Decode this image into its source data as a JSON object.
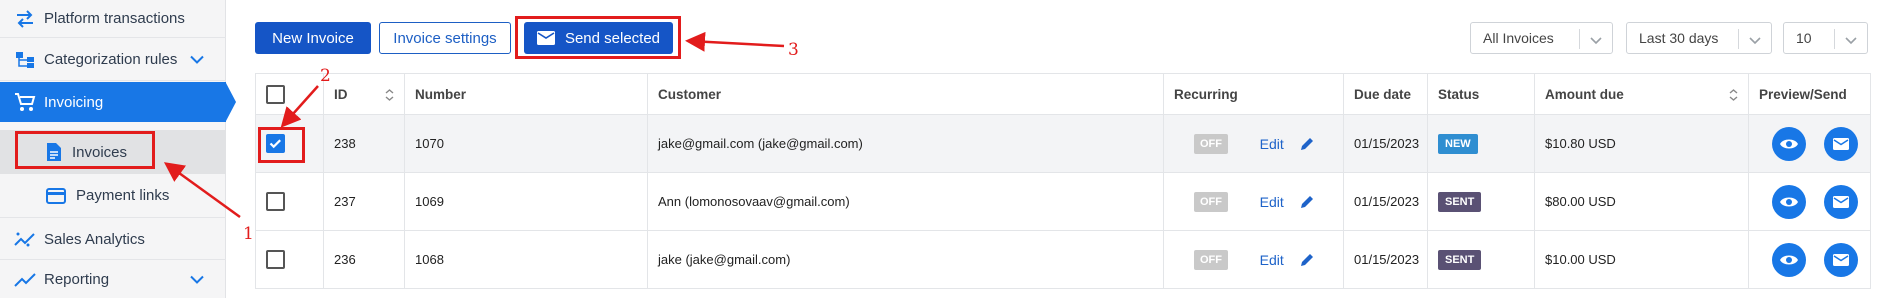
{
  "sidebar": {
    "items": [
      {
        "label": "Platform transactions",
        "icon": "swap-arrows-icon"
      },
      {
        "label": "Categorization rules",
        "icon": "hierarchy-icon"
      },
      {
        "label": "Invoicing",
        "icon": "cart-icon"
      },
      {
        "label": "Invoices",
        "icon": "document-icon"
      },
      {
        "label": "Payment links",
        "icon": "credit-card-icon"
      },
      {
        "label": "Sales Analytics",
        "icon": "analytics-icon"
      },
      {
        "label": "Reporting",
        "icon": "trend-line-icon"
      }
    ]
  },
  "toolbar": {
    "new_invoice": "New Invoice",
    "invoice_settings": "Invoice settings",
    "send_selected": "Send selected"
  },
  "filters": {
    "invoice_filter": "All Invoices",
    "date_range": "Last 30 days",
    "page_size": "10"
  },
  "table": {
    "headers": {
      "id": "ID",
      "number": "Number",
      "customer": "Customer",
      "recurring": "Recurring",
      "due_date": "Due date",
      "status": "Status",
      "amount_due": "Amount due",
      "preview_send": "Preview/Send"
    },
    "rows": [
      {
        "checked": true,
        "id": "238",
        "number": "1070",
        "customer": "jake@gmail.com (jake@gmail.com)",
        "recurring": "OFF",
        "edit": "Edit",
        "due_date": "01/15/2023",
        "status": "NEW",
        "amount": "$10.80 USD"
      },
      {
        "checked": false,
        "id": "237",
        "number": "1069",
        "customer": "Ann (lomonosovaav@gmail.com)",
        "recurring": "OFF",
        "edit": "Edit",
        "due_date": "01/15/2023",
        "status": "SENT",
        "amount": "$80.00 USD"
      },
      {
        "checked": false,
        "id": "236",
        "number": "1068",
        "customer": "jake (jake@gmail.com)",
        "recurring": "OFF",
        "edit": "Edit",
        "due_date": "01/15/2023",
        "status": "SENT",
        "amount": "$10.00 USD"
      }
    ]
  },
  "annotations": {
    "step1": "1",
    "step2": "2",
    "step3": "3"
  },
  "colors": {
    "accent": "#1877e6",
    "primary_button": "#1555c6",
    "annotation": "#e21c1c",
    "status_new": "#2f8ed1",
    "status_sent": "#5a5174"
  }
}
